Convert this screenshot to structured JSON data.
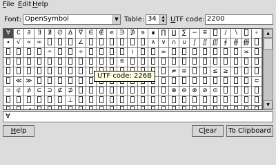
{
  "menu": {
    "file": {
      "mnemonic": "F",
      "rest": "ile"
    },
    "edit": {
      "mnemonic": "E",
      "rest": "dit"
    },
    "help": {
      "mnemonic": "H",
      "rest": "elp"
    }
  },
  "controls": {
    "font_label": "Font:",
    "font_value": "OpenSymbol",
    "table_label": "Table:",
    "table_value": "34",
    "utf_label_mnemonic": "U",
    "utf_label_rest": "TF code:",
    "utf_value": "2200"
  },
  "grid_rows": [
    [
      "∀",
      "∁",
      "∂",
      "∃",
      "∄",
      "∅",
      "∆",
      "∇",
      "∈",
      "∉",
      "∊",
      "∋",
      "∌",
      "∍",
      "∎",
      "∏",
      "∐",
      "∑",
      "−",
      "∓",
      "",
      "∕",
      "∖",
      "",
      "∘",
      "∙",
      "√",
      "∝",
      "∞"
    ],
    [
      "",
      "",
      "",
      "∠",
      "",
      "",
      "",
      "",
      "",
      "",
      "∧",
      "∨",
      "∩",
      "∪",
      "∫",
      "∬",
      "∭",
      "∮",
      "∯",
      "∰",
      "",
      "",
      "",
      "",
      "",
      "∸",
      "",
      "",
      "∻"
    ],
    [
      "",
      "",
      "",
      "",
      "≀",
      "",
      "",
      "≃",
      "",
      "",
      "",
      "",
      "",
      "",
      "",
      "≍",
      "",
      "",
      "",
      "",
      "",
      "",
      "",
      "",
      "",
      "",
      "",
      "",
      "≝"
    ],
    [
      "",
      "",
      "",
      "",
      "",
      "",
      "",
      "",
      "",
      "",
      "",
      "",
      "",
      "",
      "",
      "",
      "",
      "",
      "",
      "",
      "",
      "",
      "",
      "",
      "",
      "",
      "",
      "",
      ""
    ],
    [
      "≠",
      "≡",
      "",
      "",
      "≤",
      "≥",
      "",
      "",
      "",
      "",
      "≪",
      "≫",
      "",
      "",
      "",
      "",
      "",
      "",
      "",
      "",
      "",
      "",
      "",
      "",
      "",
      "",
      "",
      "",
      ""
    ],
    [
      "",
      "",
      "",
      "",
      "⊂",
      "⊃",
      "⊄",
      "⊅",
      "⊆",
      "⊇",
      "⊈",
      "⊉",
      "",
      "",
      "",
      "",
      "",
      "",
      "",
      "",
      "",
      "⊕",
      "⊖",
      "⊗",
      "⊘",
      "⊙",
      "",
      "",
      ""
    ],
    [
      "",
      "",
      "",
      "",
      "",
      "",
      "",
      "⊥",
      "",
      "",
      "",
      "",
      "",
      "",
      "",
      "",
      "",
      "",
      "",
      "",
      "",
      "",
      "",
      "",
      "",
      "",
      "",
      "",
      "⊿"
    ],
    [
      "",
      "",
      "",
      "",
      "",
      "",
      "",
      "",
      "",
      "",
      "",
      "",
      "",
      "",
      "",
      "",
      "",
      "",
      "",
      "",
      "",
      "",
      "",
      "",
      "",
      "",
      "",
      "",
      ""
    ],
    [
      "",
      "",
      "",
      "",
      "",
      "",
      "",
      "",
      "",
      "",
      "",
      "",
      "",
      "",
      "",
      "",
      "",
      "",
      "",
      "",
      "",
      "",
      "",
      "",
      "",
      "",
      "",
      "",
      ""
    ]
  ],
  "selected_cell": "∀",
  "tooltip": "UTF code: 226B",
  "text_area_value": "∀",
  "buttons": {
    "help": {
      "mnemonic": "H",
      "rest": "elp"
    },
    "clear": {
      "pre": "C",
      "mnemonic": "l",
      "rest": "ear"
    },
    "to_clipboard": "To Clipboard"
  },
  "icons": {
    "dropdown": "dropdown-arrow-icon",
    "spin_up": "spin-up-icon",
    "spin_down": "spin-down-icon",
    "scroll_up": "scroll-up-icon",
    "scroll_down": "scroll-down-icon"
  },
  "colors": {
    "window_bg": "#dcdcdc",
    "cell_bg": "#ffffff",
    "selected_cell_bg": "#4a4a4a",
    "tooltip_bg": "#ffffe1"
  }
}
